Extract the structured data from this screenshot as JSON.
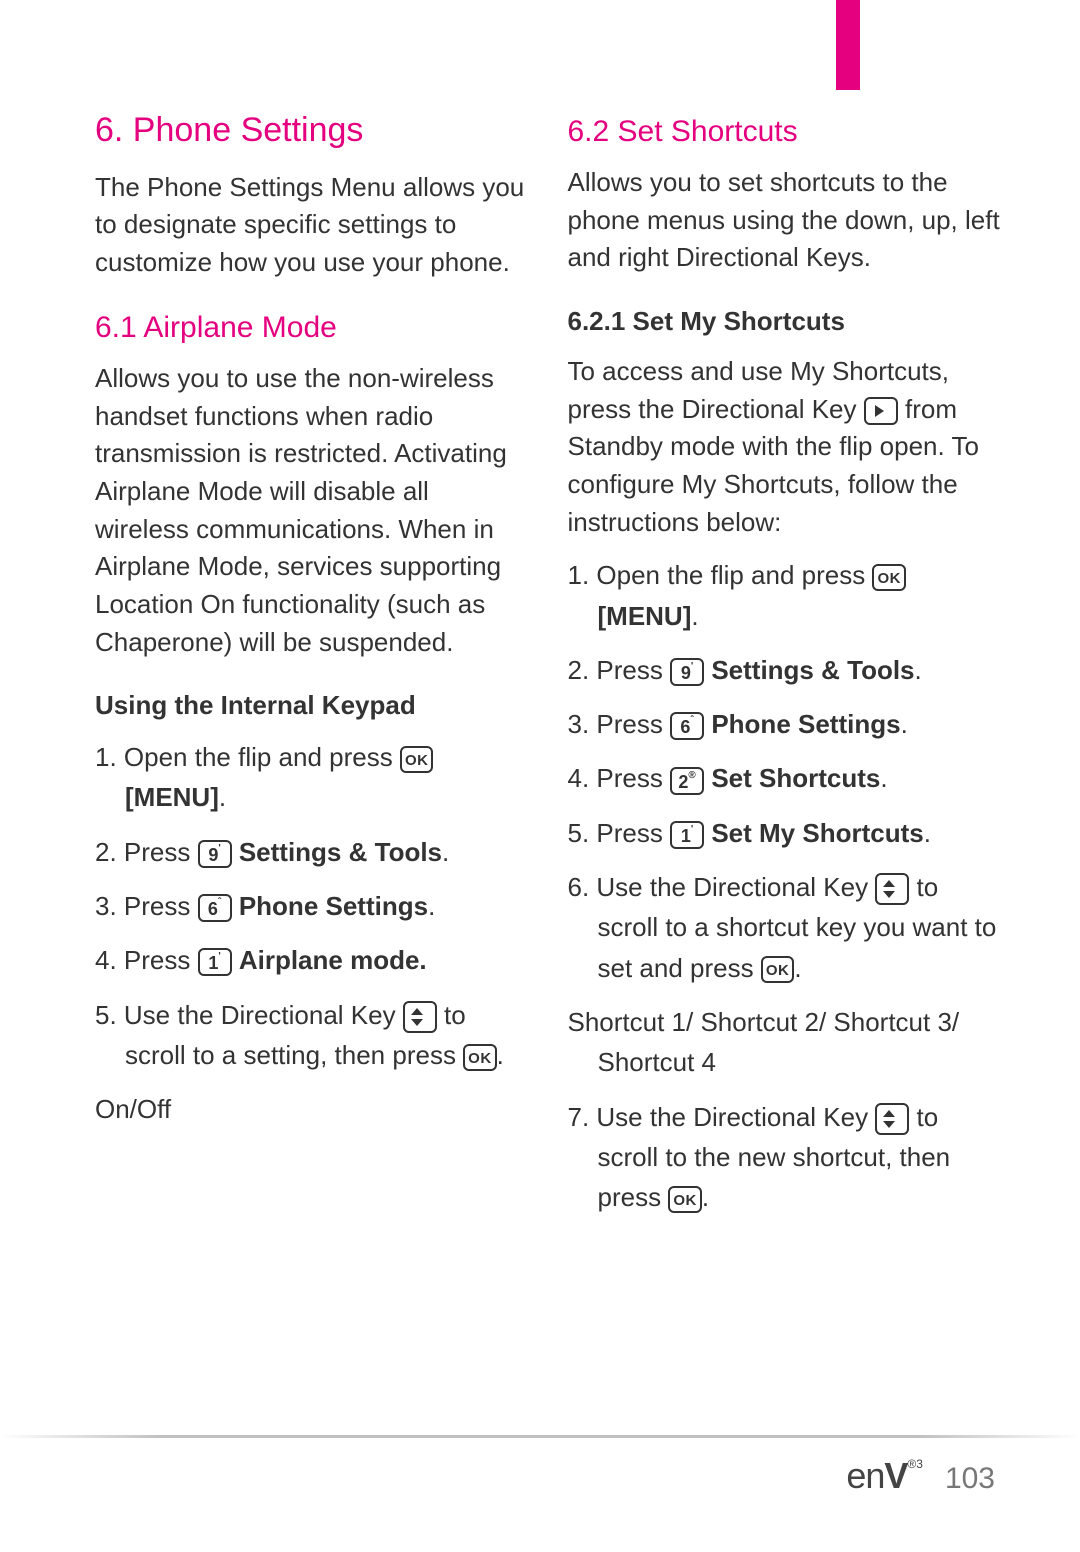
{
  "left": {
    "h1": "6. Phone Settings",
    "intro": "The Phone Settings Menu allows you to designate specific settings to customize how you use your phone.",
    "h2": "6.1 Airplane Mode",
    "desc": "Allows you to use the non-wireless handset functions when radio transmission is restricted. Activating Airplane Mode will disable all wireless communications. When in Airplane Mode, services supporting Location On functionality (such as Chaperone) will be suspended.",
    "h3": "Using the Internal Keypad",
    "s1a": "1. Open the flip and press ",
    "s1b": "[MENU]",
    "s1c": ".",
    "s2a": "2. Press ",
    "s2b": " Settings & Tools",
    "s2c": ".",
    "s3a": "3. Press ",
    "s3b": " Phone Settings",
    "s3c": ".",
    "s4a": "4. Press ",
    "s4b": " Airplane mode.",
    "s5a": "5. Use the Directional Key ",
    "s5b": " to scroll to a setting, then press ",
    "s5c": ".",
    "onoff": "On/Off"
  },
  "right": {
    "h2": "6.2 Set Shortcuts",
    "desc": "Allows you to set shortcuts to the phone menus using the down, up, left and right Directional Keys.",
    "h3": "6.2.1 Set My Shortcuts",
    "desc2a": "To access and use My Shortcuts, press the Directional Key ",
    "desc2b": " from Standby mode with the flip open. To configure My Shortcuts, follow the instructions below:",
    "s1a": "1. Open the flip and press ",
    "s1b": "[MENU]",
    "s1c": ".",
    "s2a": "2. Press ",
    "s2b": " Settings & Tools",
    "s2c": ".",
    "s3a": "3. Press ",
    "s3b": " Phone Settings",
    "s3c": ".",
    "s4a": "4. Press ",
    "s4b": " Set Shortcuts",
    "s4c": ".",
    "s5a": "5. Press ",
    "s5b": " Set My Shortcuts",
    "s5c": ".",
    "s6a": "6. Use the Directional Key ",
    "s6b": " to scroll to a shortcut key you want to set and press ",
    "s6c": ".",
    "shortcutList": "Shortcut 1/ Shortcut 2/ Shortcut 3/ Shortcut 4",
    "s7a": "7. Use the Directional Key ",
    "s7b": " to scroll to the new shortcut, then press ",
    "s7c": "."
  },
  "keys": {
    "ok": "OK",
    "k9": "9",
    "k6": "6",
    "k1": "1",
    "k2": "2"
  },
  "footer": {
    "logo_a": "en",
    "logo_b": "V",
    "logo_sup": "®3",
    "page": "103"
  }
}
